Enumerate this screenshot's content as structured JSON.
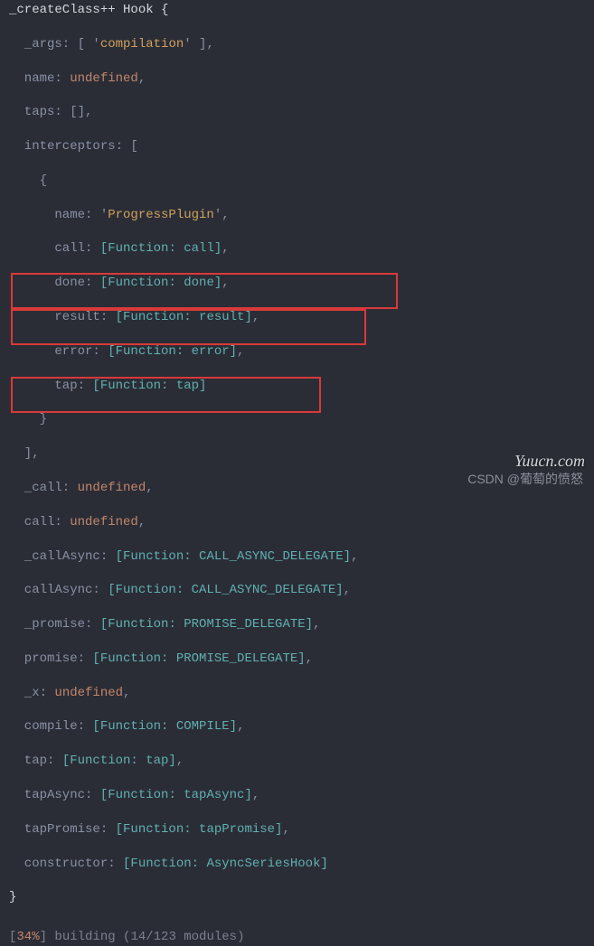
{
  "hdr": "_createClass++ Hook {",
  "p1a": "  _args: [ '",
  "p1s": "compilation",
  "p1b": "' ],",
  "p2a": "  name: ",
  "p2u": "undefined",
  "p2b": ",",
  "p3": "  taps: [],",
  "p4": "  interceptors: [",
  "p5": "    {",
  "p6a": "      name: '",
  "p6s": "ProgressPlugin",
  "p6b": "',",
  "p7a": "      call: ",
  "p7f": "[Function: call]",
  "p7b": ",",
  "p8a": "      done: ",
  "p8f": "[Function: done]",
  "p8b": ",",
  "p9a": "      result: ",
  "p9f": "[Function: result]",
  "p9b": ",",
  "p10a": "      error: ",
  "p10f": "[Function: error]",
  "p10b": ",",
  "p11a": "      tap: ",
  "p11f": "[Function: tap]",
  "p12": "    }",
  "p13": "  ],",
  "p14a": "  _call: ",
  "p14u": "undefined",
  "p14b": ",",
  "p15a": "  call: ",
  "p15u": "undefined",
  "p15b": ",",
  "p16a": "  _callAsync: ",
  "p16f": "[Function: CALL_ASYNC_DELEGATE]",
  "p16b": ",",
  "p17a": "  callAsync: ",
  "p17f": "[Function: CALL_ASYNC_DELEGATE]",
  "p17b": ",",
  "p18a": "  _promise: ",
  "p18f": "[Function: PROMISE_DELEGATE]",
  "p18b": ",",
  "p19a": "  promise: ",
  "p19f": "[Function: PROMISE_DELEGATE]",
  "p19b": ",",
  "p20a": "  _x: ",
  "p20u": "undefined",
  "p20b": ",",
  "p21a": "  compile: ",
  "p21f": "[Function: COMPILE]",
  "p21b": ",",
  "p22a": "  tap: ",
  "p22f": "[Function: tap]",
  "p22b": ",",
  "p23a": "  tapAsync: ",
  "p23f": "[Function: tapAsync]",
  "p23b": ",",
  "p24a": "  tapPromise: ",
  "p24f": "[Function: tapPromise]",
  "p24b": ",",
  "p25a": "  constructor: ",
  "p25f": "[Function: AsyncSeriesHook]",
  "p26": "}",
  "status_open": "[",
  "status_pct": "34%",
  "status_close": "]",
  "status_txt": " building (14/123 modules)",
  "wm_csdn": "CSDN @葡萄的愤怒",
  "wm_yuucn": "Yuucn.com"
}
